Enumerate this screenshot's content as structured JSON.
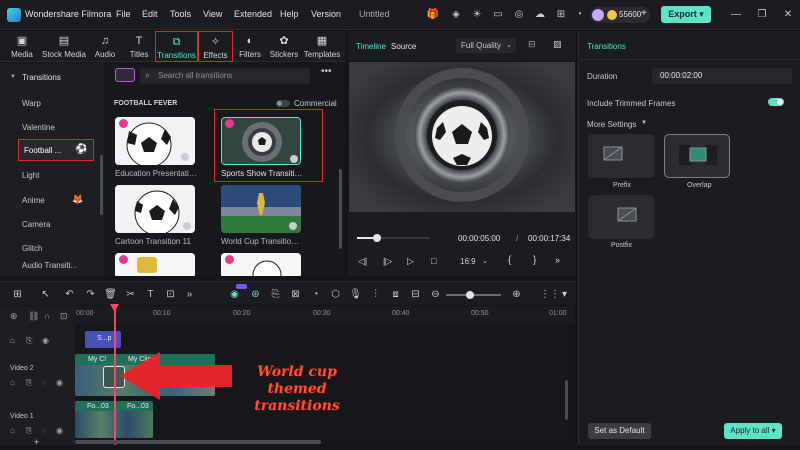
{
  "app": {
    "name": "Wondershare Filmora",
    "project": "Untitled",
    "credits": "55600",
    "export_label": "Export"
  },
  "menu": [
    "File",
    "Edit",
    "Tools",
    "View",
    "Extended",
    "Help",
    "Version"
  ],
  "library_tabs": [
    "Media",
    "Stock Media",
    "Audio",
    "Titles",
    "Transitions",
    "Effects",
    "Filters",
    "Stickers",
    "Templates"
  ],
  "sidebar": {
    "header": "Transitions",
    "items": [
      "Warp",
      "Valentine",
      "Football ...",
      "Light",
      "Anime",
      "Camera",
      "Glitch",
      "Audio Transiti..."
    ]
  },
  "browser": {
    "search_placeholder": "Search all transitions",
    "category": "FOOTBALL FEVER",
    "commercial_label": "Commercial",
    "items": [
      "Education Presentatio...",
      "Sports Show Transitio...",
      "Cartoon Transition 11",
      "World Cup Transition 11"
    ]
  },
  "preview": {
    "tab_timeline": "Timeline",
    "tab_source": "Source",
    "quality": "Full Quality",
    "current_time": "00:00:05:00",
    "separator": "/",
    "total_time": "00:00:17:34",
    "aspect": "16:9",
    "progress": 0.28
  },
  "properties": {
    "title": "Transitions",
    "duration_label": "Duration",
    "duration_value": "00:00:02:00",
    "trimmed_label": "Include Trimmed Frames",
    "more_settings": "More Settings",
    "modes": [
      "Prefix",
      "Overlap",
      "Postfix"
    ],
    "set_default": "Set as Default",
    "apply_all": "Apply to all"
  },
  "timeline": {
    "ruler": [
      "00:00",
      "00:10",
      "00:20",
      "00:30",
      "00:40",
      "00:50",
      "01:00"
    ],
    "tracks": [
      "Video 2",
      "Video 1"
    ],
    "clips": {
      "title_clip": "S...p",
      "my_clip_1": "My Cl",
      "my_clip_2": "My Clip",
      "fo_1": "Fo...03",
      "fo_2": "Fo...03"
    },
    "add_track": "+"
  },
  "annotation": "World cup themed transitions",
  "colors": {
    "accent": "#5fe3c8",
    "highlight": "#e2262b",
    "annotation": "#ff4f35",
    "clip_green": "#1f7a5c",
    "clip_title": "#4b4fb8"
  }
}
